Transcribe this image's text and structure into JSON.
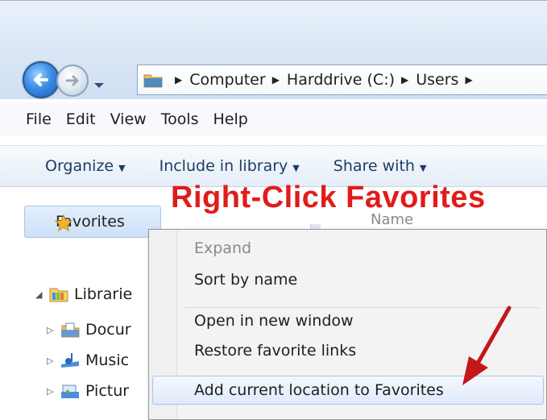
{
  "address_bar": {
    "crumbs": [
      "Computer",
      "Harddrive (C:)",
      "Users"
    ]
  },
  "menu_bar": {
    "items": [
      "File",
      "Edit",
      "View",
      "Tools",
      "Help"
    ]
  },
  "command_bar": {
    "items": [
      "Organize",
      "Include in library",
      "Share with"
    ]
  },
  "nav_pane": {
    "favorites_label": "Favorites",
    "libraries_label": "Librarie",
    "children": [
      "Docur",
      "Music",
      "Pictur"
    ]
  },
  "column_header": "Name",
  "context_menu": {
    "items": [
      {
        "label": "Expand",
        "disabled": true
      },
      {
        "label": "Sort by name"
      },
      {
        "label": "Open in new window"
      },
      {
        "label": "Restore favorite links"
      },
      {
        "label": "Add current location to Favorites",
        "highlighted": true
      }
    ]
  },
  "annotation": {
    "text": "Right-Click Favorites",
    "color": "#e11b1b"
  },
  "colors": {
    "accent_blue": "#3c8ee6",
    "highlight": "#dfeafa",
    "arrow": "#c4161c"
  },
  "icons": [
    "back-arrow-icon",
    "forward-arrow-icon",
    "folder-icon",
    "star-icon",
    "library-icon",
    "documents-icon",
    "music-icon",
    "pictures-icon"
  ]
}
